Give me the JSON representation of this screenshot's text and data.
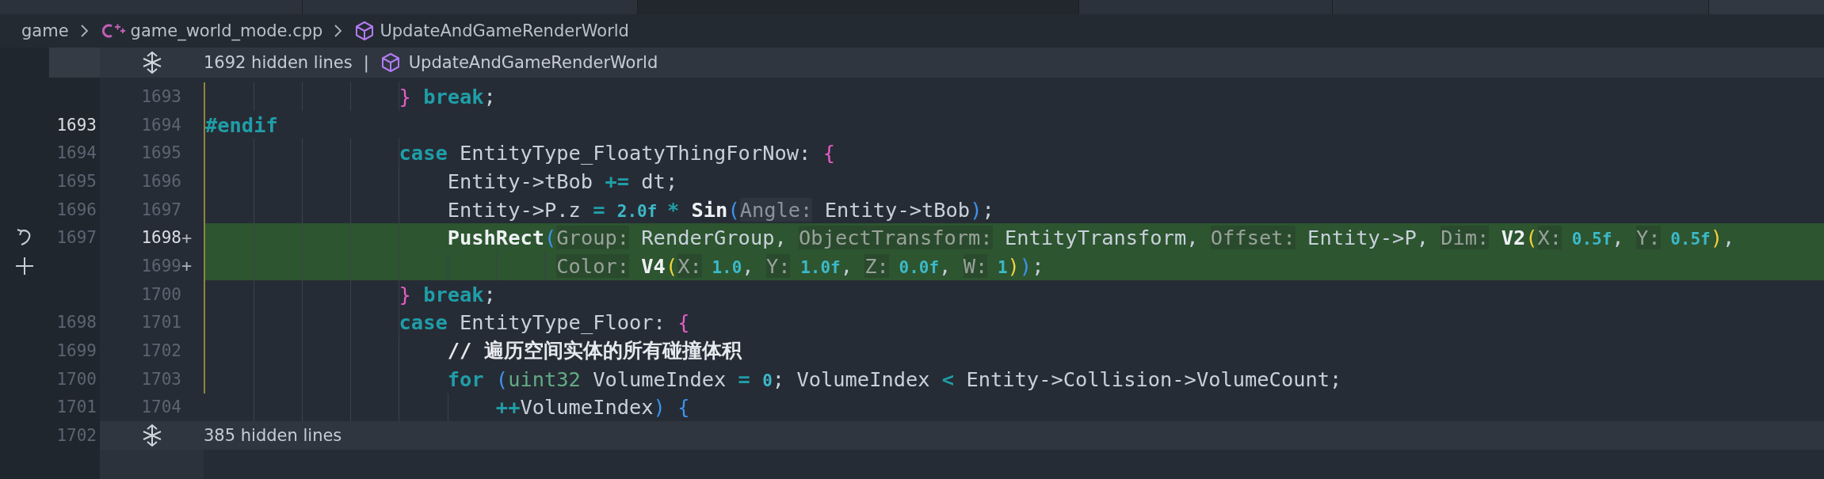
{
  "tabs": [
    {
      "selected": false
    },
    {
      "selected": false
    },
    {
      "selected": true
    },
    {
      "selected": false
    },
    {
      "selected": false
    }
  ],
  "breadcrumb": [
    {
      "kind": "folder",
      "label": "game"
    },
    {
      "kind": "cpp-file",
      "label": "game_world_mode.cpp"
    },
    {
      "kind": "function",
      "label": "UpdateAndGameRenderWorld"
    }
  ],
  "top_fold": {
    "text": "1692 hidden lines",
    "separator": "|",
    "symbol": "UpdateAndGameRenderWorld"
  },
  "lines": [
    {
      "kind": "case",
      "new": {
        "number": "1693",
        "highlighted": false
      },
      "added": false,
      "marked": true,
      "tokens": [
        {
          "kind": "pink",
          "t": "}"
        },
        {
          "kind": "kw",
          "t": " break"
        },
        {
          "kind": "plain",
          "t": ";"
        }
      ]
    },
    {
      "kind": "top",
      "old": {
        "number": "1693",
        "highlighted": true
      },
      "new": {
        "number": "1694",
        "highlighted": false
      },
      "added": false,
      "marked": true,
      "tokens": [
        {
          "kind": "kw",
          "t": "#endif"
        }
      ]
    },
    {
      "kind": "case",
      "old": {
        "number": "1694",
        "highlighted": false
      },
      "new": {
        "number": "1695",
        "highlighted": false
      },
      "added": false,
      "marked": true,
      "tokens": [
        {
          "kind": "kw",
          "t": "case"
        },
        {
          "kind": "plain",
          "t": " EntityType_FloatyThingForNow: "
        },
        {
          "kind": "pink",
          "t": "{"
        }
      ]
    },
    {
      "kind": "body",
      "old": {
        "number": "1695",
        "highlighted": false
      },
      "new": {
        "number": "1696",
        "highlighted": false
      },
      "added": false,
      "marked": true,
      "tokens": [
        {
          "kind": "plain",
          "t": "Entity->tBob "
        },
        {
          "kind": "kw",
          "t": "+="
        },
        {
          "kind": "plain",
          "t": " dt;"
        }
      ]
    },
    {
      "kind": "body",
      "old": {
        "number": "1696",
        "highlighted": false
      },
      "new": {
        "number": "1697",
        "highlighted": false
      },
      "added": false,
      "marked": true,
      "tokens": [
        {
          "kind": "plain",
          "t": "Entity->P.z "
        },
        {
          "kind": "kw",
          "t": "= "
        },
        {
          "kind": "num",
          "t": "2.0f "
        },
        {
          "kind": "kw",
          "t": "* "
        },
        {
          "kind": "fn",
          "t": "Sin"
        },
        {
          "kind": "blue",
          "t": "("
        },
        {
          "kind": "hint",
          "t": "Angle:"
        },
        {
          "kind": "plain",
          "t": " Entity->tBob"
        },
        {
          "kind": "blue",
          "t": ")"
        },
        {
          "kind": "plain",
          "t": ";"
        }
      ]
    },
    {
      "kind": "body",
      "old": {
        "number": "1697",
        "highlighted": false
      },
      "new": {
        "number": "1698",
        "highlighted": true
      },
      "marker": "+",
      "gutter": {
        "kind": "revert"
      },
      "added": true,
      "marked": true,
      "tokens": [
        {
          "kind": "fn",
          "t": "PushRect"
        },
        {
          "kind": "blue",
          "t": "("
        },
        {
          "kind": "hint",
          "t": "Group:"
        },
        {
          "kind": "plain",
          "t": " RenderGroup, "
        },
        {
          "kind": "hint",
          "t": "ObjectTransform:"
        },
        {
          "kind": "plain",
          "t": " EntityTransform, "
        },
        {
          "kind": "hint",
          "t": "Offset:"
        },
        {
          "kind": "plain",
          "t": " Entity->P, "
        },
        {
          "kind": "hint",
          "t": "Dim:"
        },
        {
          "kind": "fn",
          "t": " V2"
        },
        {
          "kind": "yellow",
          "t": "("
        },
        {
          "kind": "hint",
          "t": "X:"
        },
        {
          "kind": "num",
          "t": " 0.5f"
        },
        {
          "kind": "plain",
          "t": ", "
        },
        {
          "kind": "hint",
          "t": "Y:"
        },
        {
          "kind": "num",
          "t": " 0.5f"
        },
        {
          "kind": "yellow",
          "t": ")"
        },
        {
          "kind": "plain",
          "t": ","
        }
      ]
    },
    {
      "kind": "continuation",
      "new": {
        "number": "1699",
        "highlighted": false
      },
      "marker": "+",
      "gutter": {
        "kind": "add"
      },
      "added": true,
      "marked": true,
      "tokens": [
        {
          "kind": "hint",
          "t": "Color:"
        },
        {
          "kind": "fn",
          "t": " V4"
        },
        {
          "kind": "yellow",
          "t": "("
        },
        {
          "kind": "hint",
          "t": "X:"
        },
        {
          "kind": "num",
          "t": " 1.0"
        },
        {
          "kind": "plain",
          "t": ", "
        },
        {
          "kind": "hint",
          "t": "Y:"
        },
        {
          "kind": "num",
          "t": " 1.0f"
        },
        {
          "kind": "plain",
          "t": ", "
        },
        {
          "kind": "hint",
          "t": "Z:"
        },
        {
          "kind": "num",
          "t": " 0.0f"
        },
        {
          "kind": "plain",
          "t": ", "
        },
        {
          "kind": "hint",
          "t": "W:"
        },
        {
          "kind": "num",
          "t": " 1"
        },
        {
          "kind": "yellow",
          "t": ")"
        },
        {
          "kind": "blue",
          "t": ")"
        },
        {
          "kind": "plain",
          "t": ";"
        }
      ]
    },
    {
      "kind": "case",
      "new": {
        "number": "1700",
        "highlighted": false
      },
      "added": false,
      "marked": true,
      "tokens": [
        {
          "kind": "pink",
          "t": "}"
        },
        {
          "kind": "kw",
          "t": " break"
        },
        {
          "kind": "plain",
          "t": ";"
        }
      ]
    },
    {
      "kind": "case",
      "old": {
        "number": "1698",
        "highlighted": false
      },
      "new": {
        "number": "1701",
        "highlighted": false
      },
      "added": false,
      "marked": true,
      "tokens": [
        {
          "kind": "kw",
          "t": "case"
        },
        {
          "kind": "plain",
          "t": " EntityType_Floor: "
        },
        {
          "kind": "pink",
          "t": "{"
        }
      ]
    },
    {
      "kind": "body",
      "old": {
        "number": "1699",
        "highlighted": false
      },
      "new": {
        "number": "1702",
        "highlighted": false
      },
      "added": false,
      "marked": true,
      "tokens": [
        {
          "kind": "comment",
          "t": "// 遍历空间实体的所有碰撞体积"
        }
      ]
    },
    {
      "kind": "body",
      "old": {
        "number": "1700",
        "highlighted": false
      },
      "new": {
        "number": "1703",
        "highlighted": false
      },
      "added": false,
      "marked": true,
      "tokens": [
        {
          "kind": "kw",
          "t": "for"
        },
        {
          "kind": "blue",
          "t": " ("
        },
        {
          "kind": "type",
          "t": "uint32"
        },
        {
          "kind": "plain",
          "t": " VolumeIndex "
        },
        {
          "kind": "kw",
          "t": "= "
        },
        {
          "kind": "num",
          "t": "0"
        },
        {
          "kind": "plain",
          "t": "; VolumeIndex "
        },
        {
          "kind": "kw",
          "t": "< "
        },
        {
          "kind": "plain",
          "t": "Entity->Collision->VolumeCount;"
        }
      ]
    },
    {
      "kind": "inner",
      "old": {
        "number": "1701",
        "highlighted": false
      },
      "new": {
        "number": "1704",
        "highlighted": false
      },
      "added": false,
      "marked": false,
      "tokens": [
        {
          "kind": "kw",
          "t": "++"
        },
        {
          "kind": "plain",
          "t": "VolumeIndex"
        },
        {
          "kind": "blue",
          "t": ") {"
        }
      ]
    }
  ],
  "bottom_fold": {
    "old": "1702",
    "text": "385 hidden lines"
  }
}
